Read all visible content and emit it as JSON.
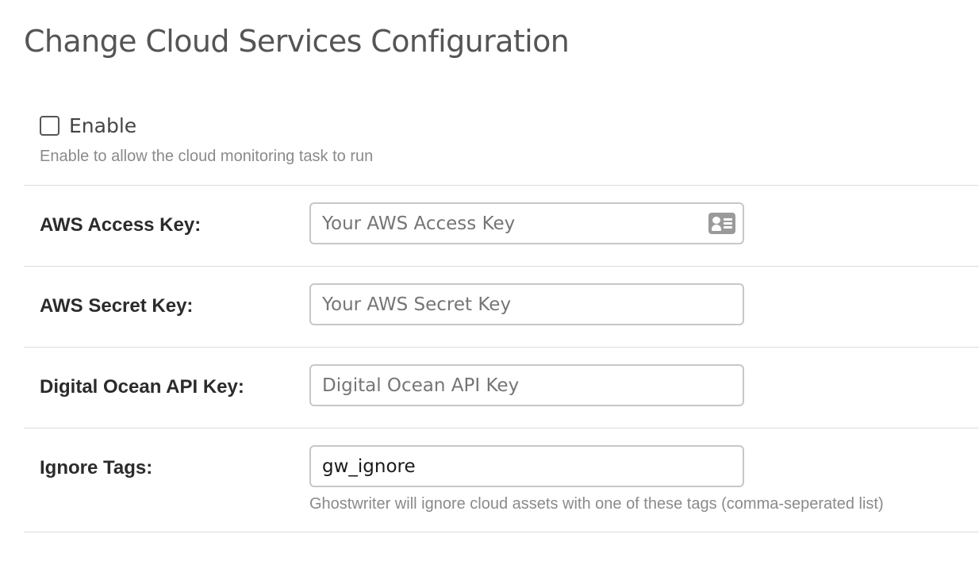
{
  "page": {
    "title": "Change Cloud Services Configuration"
  },
  "enable": {
    "label": "Enable",
    "checked": false,
    "help": "Enable to allow the cloud monitoring task to run"
  },
  "fields": {
    "aws_access_key": {
      "label": "AWS Access Key:",
      "value": "",
      "placeholder": "Your AWS Access Key",
      "icon": "contact-card-icon"
    },
    "aws_secret_key": {
      "label": "AWS Secret Key:",
      "value": "",
      "placeholder": "Your AWS Secret Key"
    },
    "digital_ocean_api_key": {
      "label": "Digital Ocean API Key:",
      "value": "",
      "placeholder": "Digital Ocean API Key"
    },
    "ignore_tags": {
      "label": "Ignore Tags:",
      "value": "gw_ignore",
      "placeholder": "",
      "help": "Ghostwriter will ignore cloud assets with one of these tags (comma-seperated list)"
    }
  },
  "colors": {
    "title": "#555555",
    "label": "#2b2b2b",
    "help_text": "#8a8a8a",
    "input_border": "#c7c7c7",
    "divider": "#dddddd"
  }
}
